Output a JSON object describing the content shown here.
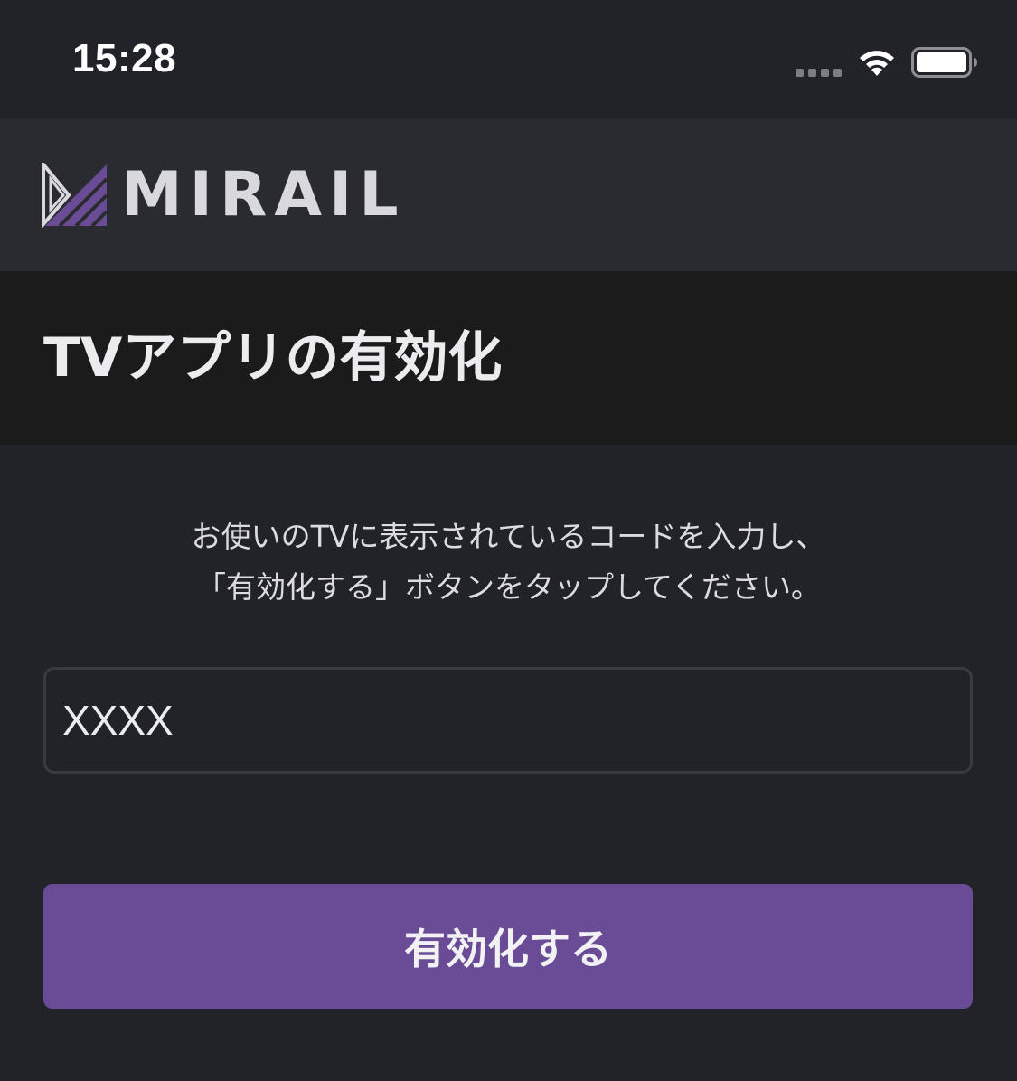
{
  "status_bar": {
    "time": "15:28",
    "icons": [
      "signal-dots-icon",
      "wifi-icon",
      "battery-icon"
    ]
  },
  "header": {
    "brand": "MIRAIL",
    "logo_icon": "mirail-logo-icon"
  },
  "page": {
    "title": "TVアプリの有効化",
    "instruction_line1": "お使いのTVに表示されているコードを入力し、",
    "instruction_line2": "「有効化する」ボタンをタップしてください。"
  },
  "code_input": {
    "value": "",
    "placeholder": "XXXX"
  },
  "activate_button": {
    "label": "有効化する"
  },
  "colors": {
    "background": "#222329",
    "header": "#2a2b31",
    "title_band": "#1b1b1c",
    "accent": "#6a4c96"
  }
}
